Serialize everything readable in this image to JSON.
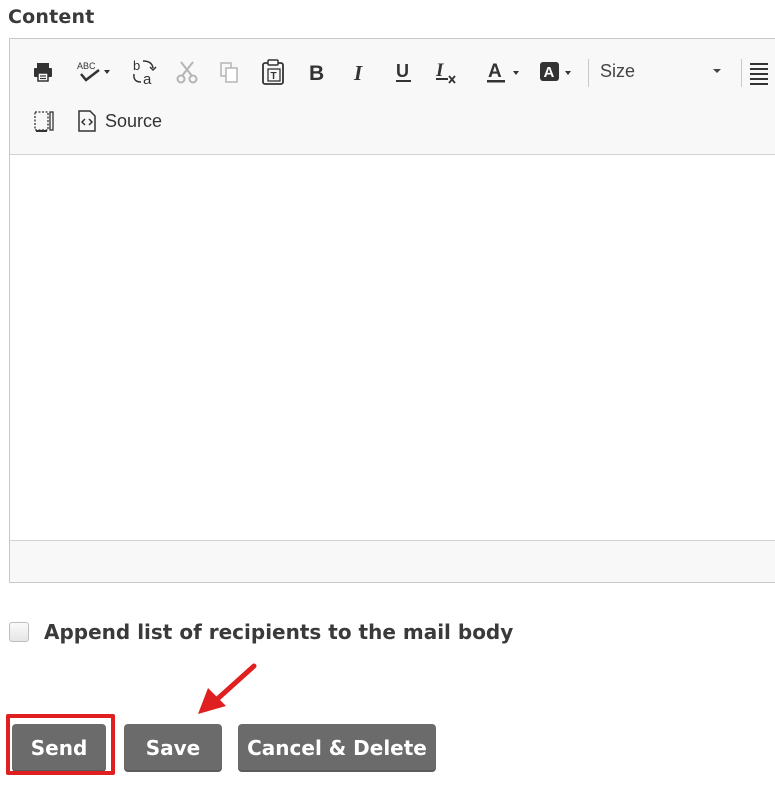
{
  "content_label": "Content",
  "toolbar": {
    "size_label": "Size",
    "source_label": "Source",
    "icons": [
      "print-icon",
      "spellcheck-icon",
      "replace-icon",
      "cut-icon",
      "copy-icon",
      "paste-text-icon",
      "bold-icon",
      "italic-icon",
      "underline-icon",
      "remove-format-icon",
      "text-color-icon",
      "background-color-icon",
      "align-justify-icon",
      "show-blocks-icon",
      "source-icon"
    ]
  },
  "append_label": "Append list of recipients to the mail body",
  "buttons": {
    "send": "Send",
    "save": "Save",
    "cancel_delete": "Cancel & Delete"
  },
  "colors": {
    "button_bg": "#6b6b6b",
    "highlight": "#e02020"
  }
}
